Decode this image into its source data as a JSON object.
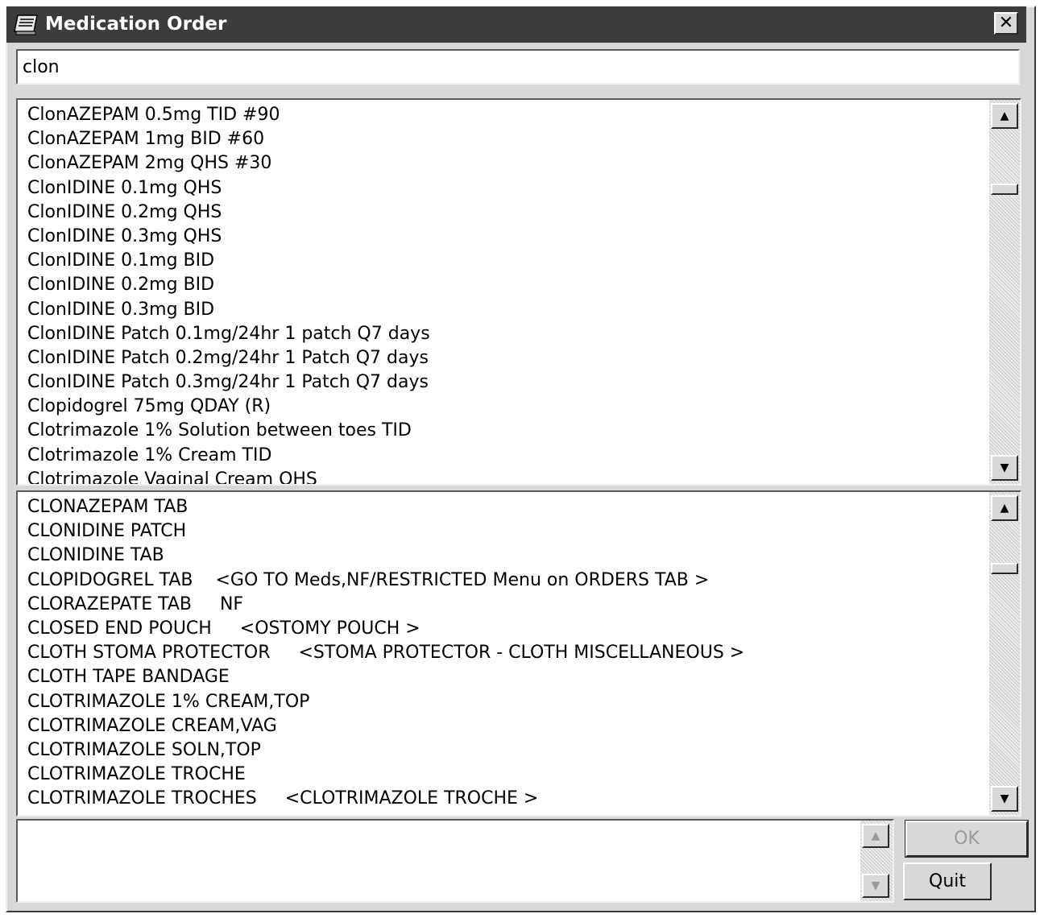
{
  "window": {
    "title": "Medication Order",
    "close_glyph": "✕"
  },
  "search": {
    "value": "clon"
  },
  "orders_list": {
    "items": [
      "ClonAZEPAM 0.5mg TID #90",
      "ClonAZEPAM 1mg BID #60",
      "ClonAZEPAM 2mg QHS #30",
      "ClonIDINE 0.1mg QHS",
      "ClonIDINE 0.2mg QHS",
      "ClonIDINE 0.3mg QHS",
      "ClonIDINE 0.1mg BID",
      "ClonIDINE 0.2mg BID",
      "ClonIDINE 0.3mg BID",
      "ClonIDINE Patch 0.1mg/24hr 1 patch Q7 days",
      "ClonIDINE Patch 0.2mg/24hr 1 Patch Q7 days",
      "ClonIDINE Patch 0.3mg/24hr 1 Patch Q7 days",
      "Clopidogrel 75mg QDAY (R)",
      "Clotrimazole 1% Solution between toes TID",
      "Clotrimazole 1% Cream TID",
      "Clotrimazole Vaginal Cream QHS"
    ]
  },
  "drug_list": {
    "items": [
      "CLONAZEPAM TAB",
      "CLONIDINE PATCH",
      "CLONIDINE TAB",
      "CLOPIDOGREL TAB    <GO TO Meds,NF/RESTRICTED Menu on ORDERS TAB >",
      "CLORAZEPATE TAB     NF",
      "CLOSED END POUCH     <OSTOMY POUCH >",
      "CLOTH STOMA PROTECTOR     <STOMA PROTECTOR - CLOTH MISCELLANEOUS >",
      "CLOTH TAPE BANDAGE",
      "CLOTRIMAZOLE 1% CREAM,TOP",
      "CLOTRIMAZOLE CREAM,VAG",
      "CLOTRIMAZOLE SOLN,TOP",
      "CLOTRIMAZOLE TROCHE",
      "CLOTRIMAZOLE TROCHES     <CLOTRIMAZOLE TROCHE >"
    ]
  },
  "scroll": {
    "up_glyph": "▲",
    "down_glyph": "▼"
  },
  "buttons": {
    "ok_label": "OK",
    "quit_label": "Quit"
  },
  "icons": {
    "title_icon": "order-form-icon"
  },
  "colors": {
    "titlebar": "#3c3c3c",
    "face": "#d8d8d8",
    "disabled_text": "#9a9a9a"
  }
}
